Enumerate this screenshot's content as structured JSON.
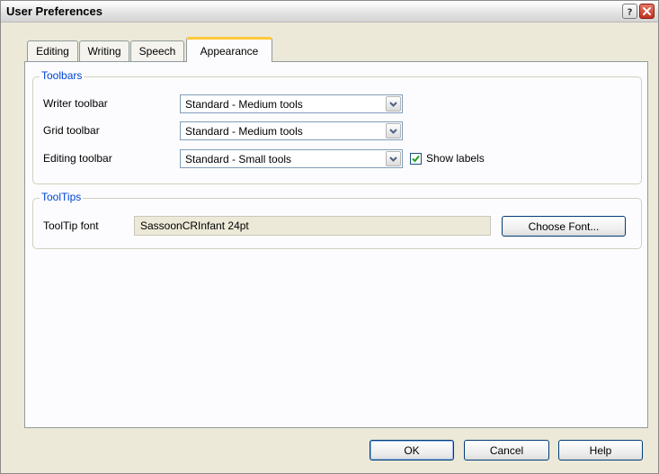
{
  "window": {
    "title": "User Preferences",
    "help_icon": "question-mark-icon",
    "close_icon": "close-x-icon",
    "colors": {
      "title_bg": "#e2e2e2",
      "close": "#c0321f",
      "legend": "#0046d5",
      "active_tab_accent": "#ffc83c"
    }
  },
  "tabs": [
    {
      "label": "Editing"
    },
    {
      "label": "Writing"
    },
    {
      "label": "Speech"
    },
    {
      "label": "Appearance",
      "active": true
    }
  ],
  "toolbars": {
    "legend": "Toolbars",
    "rows": [
      {
        "label": "Writer toolbar",
        "value": "Standard - Medium tools"
      },
      {
        "label": "Grid toolbar",
        "value": "Standard - Medium tools"
      },
      {
        "label": "Editing toolbar",
        "value": "Standard - Small tools"
      }
    ],
    "show_labels": {
      "label": "Show labels",
      "checked": true
    }
  },
  "tooltips": {
    "legend": "ToolTips",
    "font_label": "ToolTip font",
    "font_value": "SassoonCRInfant 24pt",
    "choose_font_button": "Choose Font..."
  },
  "footer": {
    "ok": "OK",
    "cancel": "Cancel",
    "help": "Help"
  }
}
